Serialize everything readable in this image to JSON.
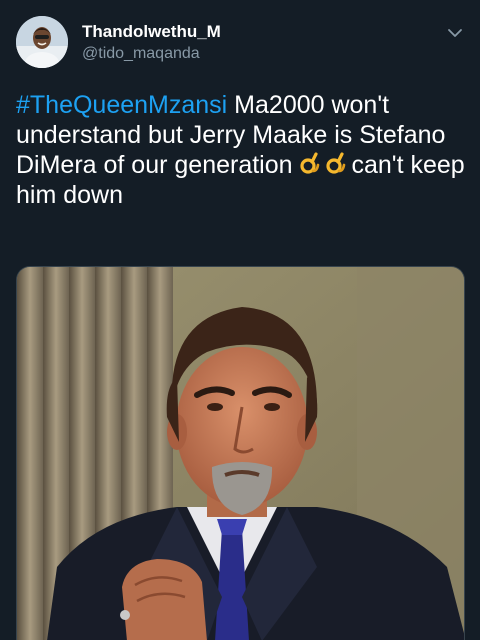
{
  "user": {
    "display_name": "Thandolwethu_M",
    "handle": "@tido_maqanda"
  },
  "tweet": {
    "hashtag": "#TheQueenMzansi",
    "text_after_hashtag": " Ma2000 won't understand but Jerry Maake is Stefano DiMera of our generation ",
    "emoji_name": "ok-hand-emoji",
    "text_after_emoji": "can't keep him down"
  },
  "icons": {
    "menu": "chevron-down-icon"
  },
  "colors": {
    "background": "#141d26",
    "link": "#1da1f2",
    "secondary_text": "#8899a6",
    "emoji": "#f5b82e"
  }
}
